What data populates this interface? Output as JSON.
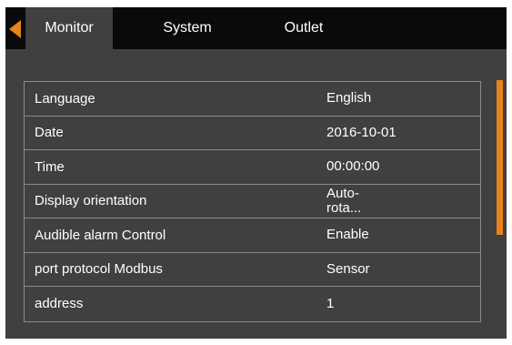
{
  "tabs": {
    "monitor": "Monitor",
    "system": "System",
    "outlet": "Outlet"
  },
  "settings": [
    {
      "label": "Language",
      "value": "English"
    },
    {
      "label": "Date",
      "value": "2016-10-01"
    },
    {
      "label": "Time",
      "value": "00:00:00"
    },
    {
      "label": "Display orientation",
      "value": "Auto-\nrota..."
    },
    {
      "label": "Audible alarm Control",
      "value": "Enable"
    },
    {
      "label": "port protocol Modbus",
      "value": "Sensor"
    },
    {
      "label": "address",
      "value": "1"
    }
  ],
  "colors": {
    "accent": "#e8821c",
    "panel": "#404040",
    "topbar": "#0a0a0a",
    "border": "#8a8a8a"
  },
  "icons": {
    "back": "back-arrow-icon"
  }
}
